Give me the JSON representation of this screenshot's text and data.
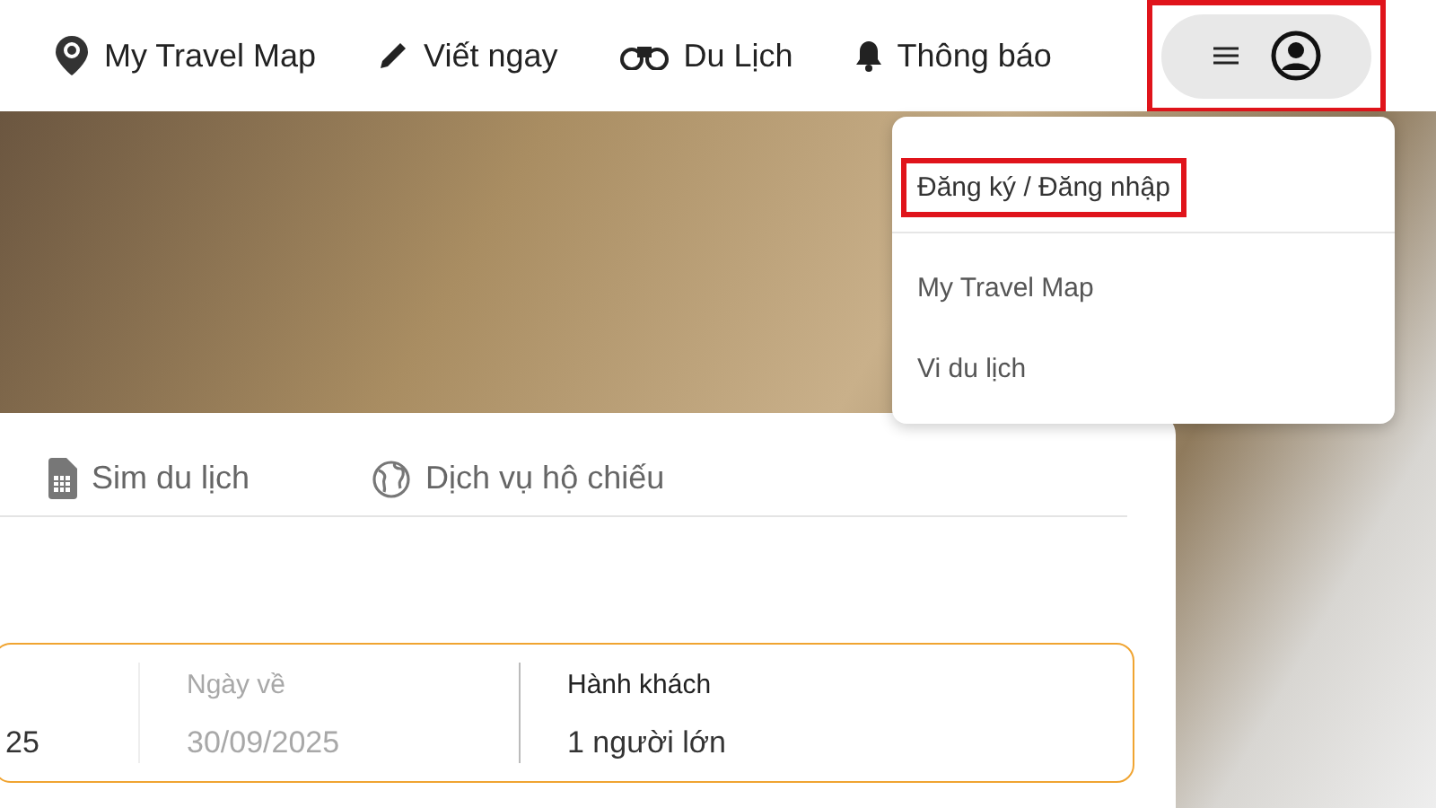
{
  "nav": {
    "items": [
      {
        "kind": "pin",
        "label": "My Travel Map"
      },
      {
        "kind": "pencil",
        "label": "Viết ngay"
      },
      {
        "kind": "binoculars",
        "label": "Du Lịch"
      },
      {
        "kind": "bell",
        "label": "Thông báo"
      }
    ],
    "menu_button": {
      "expanded": true,
      "highlighted": true
    }
  },
  "dropdown": {
    "items": [
      {
        "label": "Đăng ký / Đăng nhập",
        "highlighted": true
      },
      {
        "label": "My Travel Map",
        "highlighted": false
      },
      {
        "label": "Vi du lịch",
        "highlighted": false
      }
    ]
  },
  "search_card": {
    "tabs": [
      {
        "kind": "sim",
        "label": "Sim du lịch"
      },
      {
        "kind": "globe",
        "label": "Dịch vụ hộ chiếu"
      }
    ],
    "fields": [
      {
        "value": "25",
        "disabled": false
      },
      {
        "label": "Ngày về",
        "value": "30/09/2025",
        "disabled": true
      },
      {
        "label": "Hành khách",
        "value": "1 người lớn",
        "disabled": false
      }
    ]
  }
}
